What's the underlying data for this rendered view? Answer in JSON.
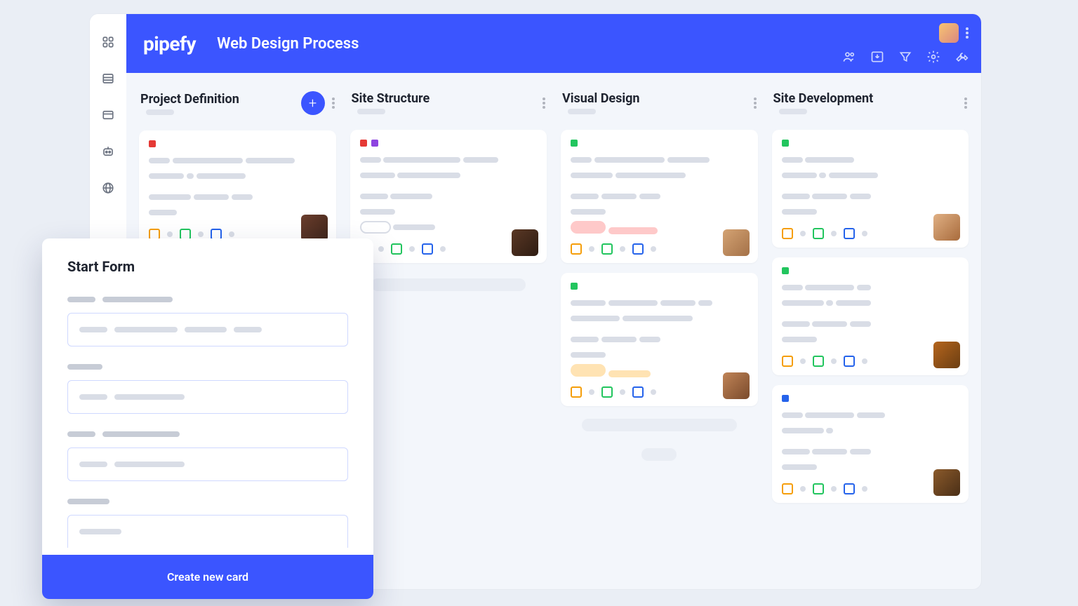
{
  "brand": "pipefy",
  "header": {
    "title": "Web Design Process"
  },
  "sidebar": {
    "icons": [
      "grid-icon",
      "list-icon",
      "card-icon",
      "automation-icon",
      "web-icon"
    ]
  },
  "header_icons": [
    "members-icon",
    "import-icon",
    "filter-icon",
    "settings-icon",
    "tools-icon"
  ],
  "columns": [
    {
      "title": "Project Definition",
      "has_add": true
    },
    {
      "title": "Site Structure",
      "has_add": false
    },
    {
      "title": "Visual Design",
      "has_add": false
    },
    {
      "title": "Site Development",
      "has_add": false
    }
  ],
  "modal": {
    "title": "Start Form",
    "submit": "Create new card"
  }
}
